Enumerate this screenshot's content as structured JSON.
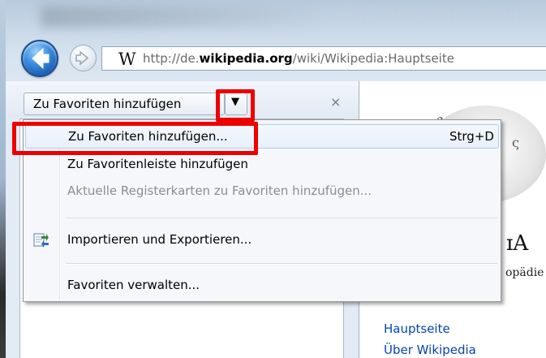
{
  "browser": {
    "address": {
      "site_icon_text": "W",
      "url_prefix": "http://de.",
      "url_domain": "wikipedia.org",
      "url_path": "/wiki/Wikipedia:Hauptseite"
    }
  },
  "favorites_pane": {
    "add_button_label": "Zu Favoriten hinzufügen",
    "dropdown_arrow": "▼",
    "close_glyph": "×"
  },
  "menu": {
    "items": [
      {
        "label": "Zu Favoriten hinzufügen...",
        "accel": "Strg+D",
        "enabled": true,
        "highlighted": true
      },
      {
        "label": "Zu Favoritenleiste hinzufügen",
        "enabled": true
      },
      {
        "label": "Aktuelle Registerkarten zu Favoriten hinzufügen...",
        "enabled": false
      },
      {
        "label": "Importieren und Exportieren...",
        "enabled": true,
        "icon": "import-export-icon"
      },
      {
        "label": "Favoriten verwalten...",
        "enabled": true
      }
    ]
  },
  "page": {
    "brand_fragment": "ɪA",
    "brand_sub_fragment": "opädie",
    "nav_links": [
      "Hauptseite",
      "Über Wikipedia"
    ]
  },
  "annotations": {
    "color": "#ee0000"
  }
}
